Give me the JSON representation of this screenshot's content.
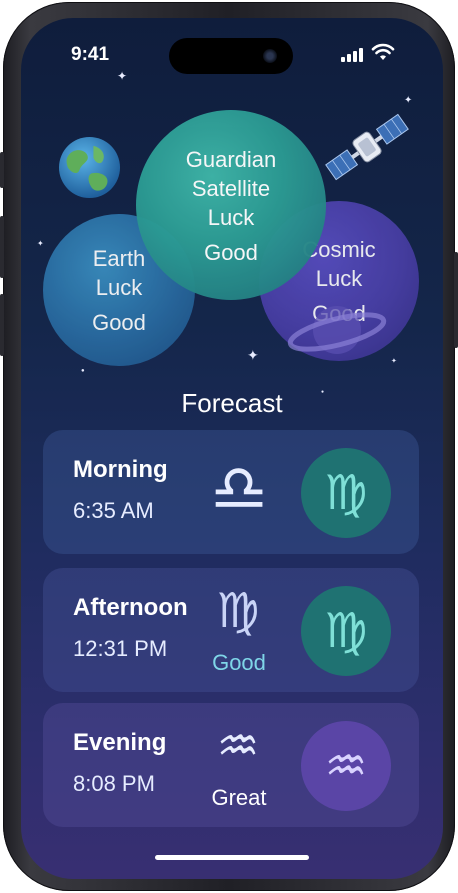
{
  "status_bar": {
    "time": "9:41"
  },
  "bubbles": {
    "guardian": {
      "title_line1": "Guardian",
      "title_line2": "Satellite",
      "title_line3": "Luck",
      "value": "Good"
    },
    "earth": {
      "title_line1": "Earth",
      "title_line2": "Luck",
      "value": "Good"
    },
    "cosmic": {
      "title_line1": "Cosmic",
      "title_line2": "Luck",
      "value": "Good"
    }
  },
  "forecast": {
    "title": "Forecast",
    "items": [
      {
        "period": "Morning",
        "time": "6:35 AM",
        "sign_glyph": "♎",
        "rating": "",
        "circle_glyph": "♍",
        "circle_color": "#1f7272"
      },
      {
        "period": "Afternoon",
        "time": "12:31 PM",
        "sign_glyph": "♍",
        "rating": "Good",
        "circle_glyph": "♍",
        "circle_color": "#1f7272"
      },
      {
        "period": "Evening",
        "time": "8:08 PM",
        "sign_glyph": "♒",
        "rating": "Great",
        "circle_glyph": "♒",
        "circle_color": "#5a45a6"
      }
    ]
  },
  "colors": {
    "good": "#7fd6e8",
    "great": "#ffffff",
    "accent_teal": "#2b9a93",
    "accent_purple": "#5a45a6"
  },
  "icons": [
    "earth-globe-icon",
    "satellite-icon",
    "ringed-planet-icon",
    "libra-icon",
    "virgo-icon",
    "aquarius-icon",
    "signal-icon",
    "wifi-icon"
  ]
}
